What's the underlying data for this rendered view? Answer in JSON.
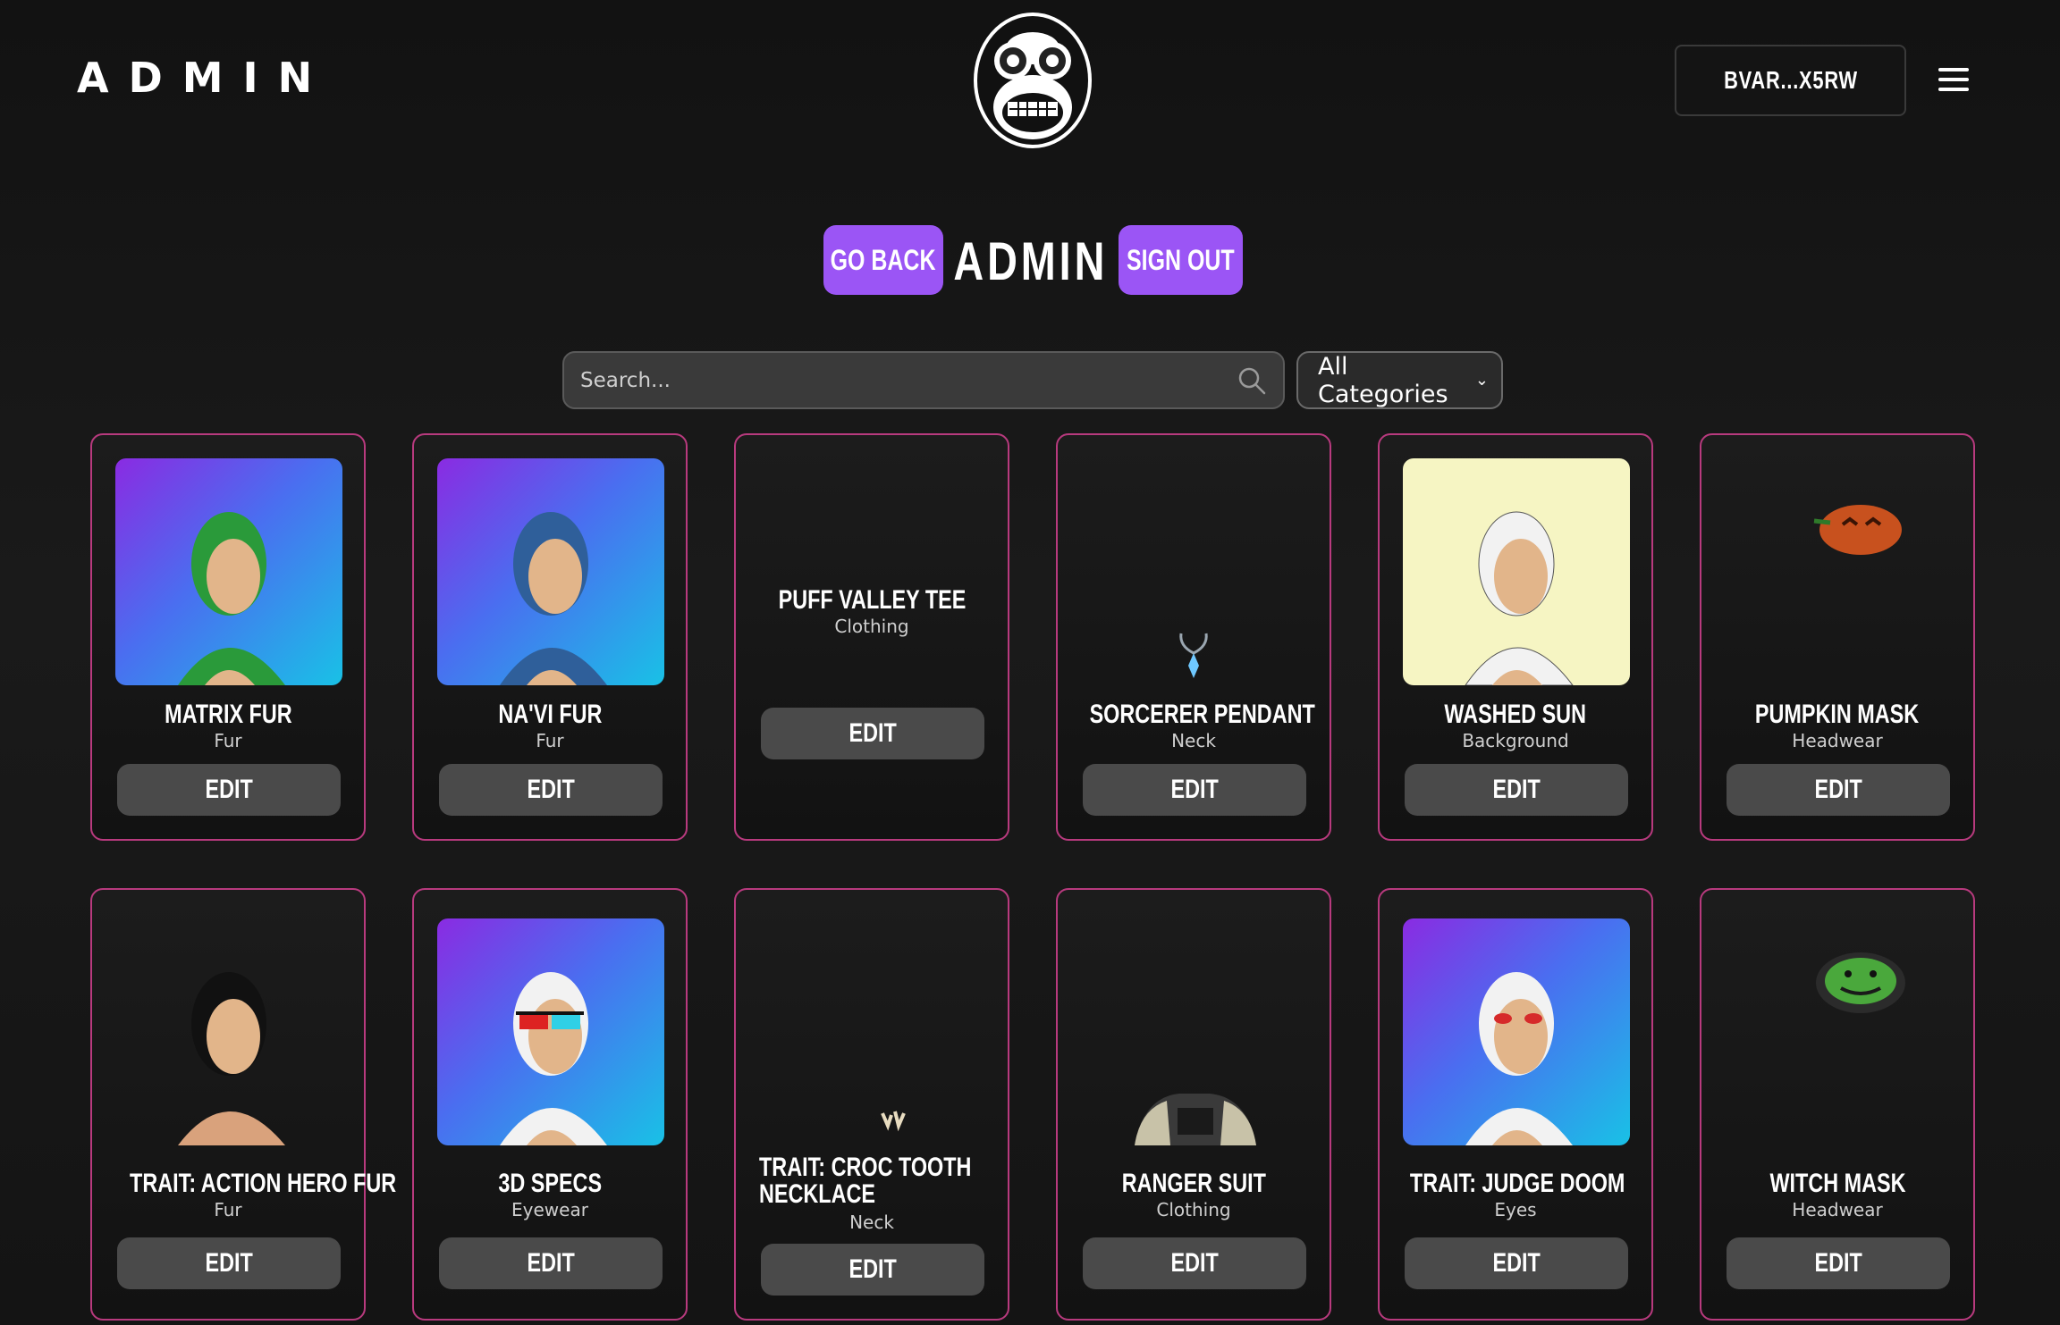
{
  "header": {
    "brand": "ADMIN",
    "wallet": "BVAR...X5RW"
  },
  "title_row": {
    "go_back": "GO BACK",
    "title": "ADMIN",
    "sign_out": "SIGN OUT"
  },
  "search": {
    "placeholder": "Search...",
    "category": "All Categories"
  },
  "edit_label": "EDIT",
  "colors": {
    "accent": "#9b55f5",
    "card_border": "#b83a7e",
    "edit_button": "#4a4a4a"
  },
  "cards": [
    {
      "name": "MATRIX FUR",
      "category": "Fur"
    },
    {
      "name": "NA'VI FUR",
      "category": "Fur"
    },
    {
      "name": "PUFF VALLEY TEE",
      "category": "Clothing"
    },
    {
      "name": "SORCERER PENDANT",
      "category": "Neck"
    },
    {
      "name": "WASHED SUN",
      "category": "Background"
    },
    {
      "name": "PUMPKIN MASK",
      "category": "Headwear"
    },
    {
      "name": "TRAIT: ACTION HERO FUR",
      "category": "Fur"
    },
    {
      "name": "3D SPECS",
      "category": "Eyewear"
    },
    {
      "name": "TRAIT: CROC TOOTH NECKLACE",
      "category": "Neck"
    },
    {
      "name": "RANGER SUIT",
      "category": "Clothing"
    },
    {
      "name": "TRAIT: JUDGE DOOM",
      "category": "Eyes"
    },
    {
      "name": "WITCH MASK",
      "category": "Headwear"
    }
  ]
}
